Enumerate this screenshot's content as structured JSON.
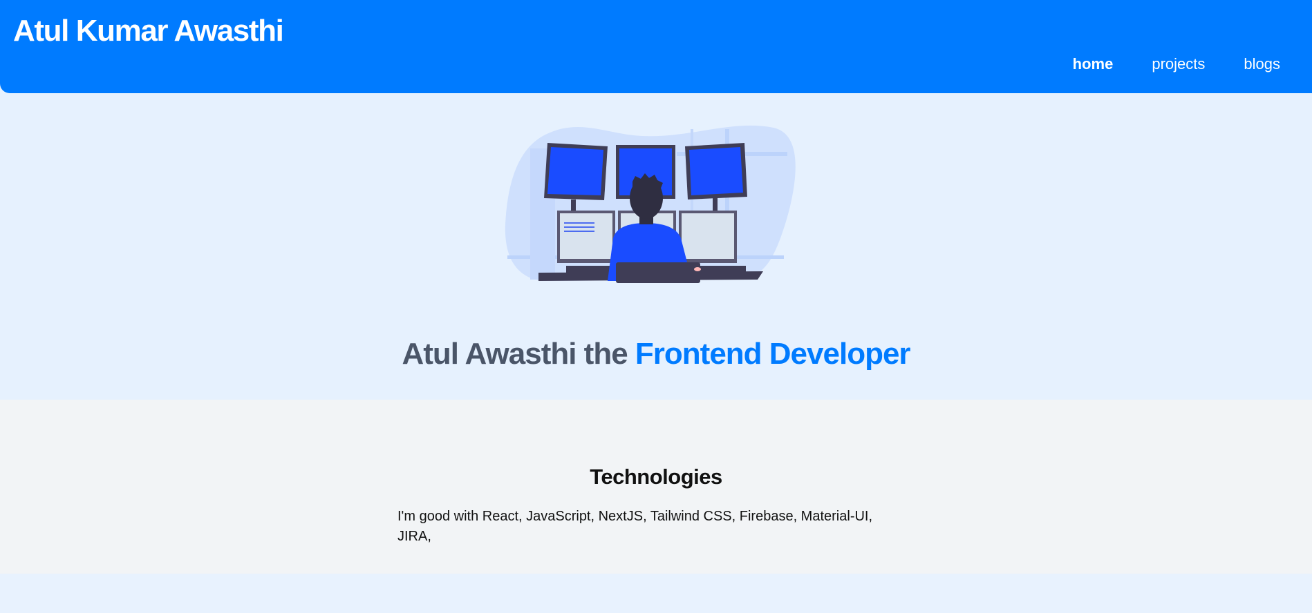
{
  "header": {
    "brand": "Atul Kumar Awasthi",
    "nav": [
      {
        "label": "home",
        "active": true
      },
      {
        "label": "projects",
        "active": false
      },
      {
        "label": "blogs",
        "active": false
      }
    ]
  },
  "hero": {
    "title_prefix": "Atul Awasthi the ",
    "title_accent": "Frontend Developer",
    "illustration": "developer-at-monitors-illustration"
  },
  "technologies": {
    "heading": "Technologies",
    "text": "I'm good with React, JavaScript, NextJS, Tailwind CSS, Firebase, Material-UI, JIRA,"
  },
  "colors": {
    "primary": "#007bff",
    "hero_background": "#e6f1fe",
    "section_background": "#f2f4f6",
    "title_gray": "#4a5568"
  }
}
